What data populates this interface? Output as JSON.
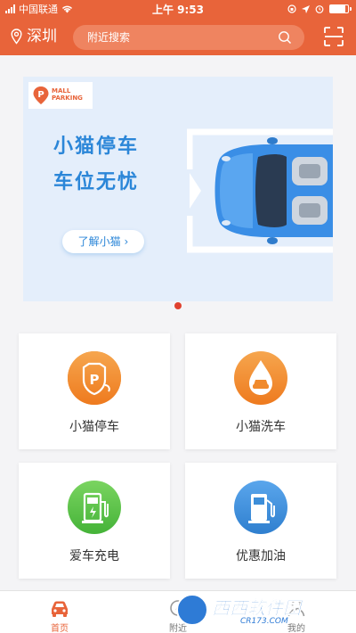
{
  "status_bar": {
    "carrier": "中国联通",
    "time": "上午 9:53",
    "battery_level": 0.85
  },
  "header": {
    "city": "深圳",
    "search_placeholder": "附近搜索"
  },
  "banner": {
    "logo_line1": "MALL",
    "logo_line2": "PARKING",
    "logo_mark": "P",
    "title_line1": "小猫停车",
    "title_line2": "车位无忧",
    "button_label": "了解小猫 ",
    "button_chevron": "›"
  },
  "services": [
    {
      "label": "小猫停车",
      "icon": "parking-icon",
      "color": "#f08a2c"
    },
    {
      "label": "小猫洗车",
      "icon": "car-wash-icon",
      "color": "#f08a2c"
    },
    {
      "label": "爱车充电",
      "icon": "charging-icon",
      "color": "#58c34a"
    },
    {
      "label": "优惠加油",
      "icon": "fuel-icon",
      "color": "#3d8ed9"
    }
  ],
  "tabbar": {
    "tabs": [
      {
        "label": "首页",
        "icon": "car-icon",
        "active": true
      },
      {
        "label": "附近",
        "icon": "nearby-icon",
        "active": false
      },
      {
        "label": "我的",
        "icon": "profile-icon",
        "active": false
      }
    ]
  },
  "watermark": {
    "title": "西西软件园",
    "subtitle": "CR173.COM"
  },
  "colors": {
    "accent": "#e8643a",
    "banner_text": "#2b86d8"
  }
}
